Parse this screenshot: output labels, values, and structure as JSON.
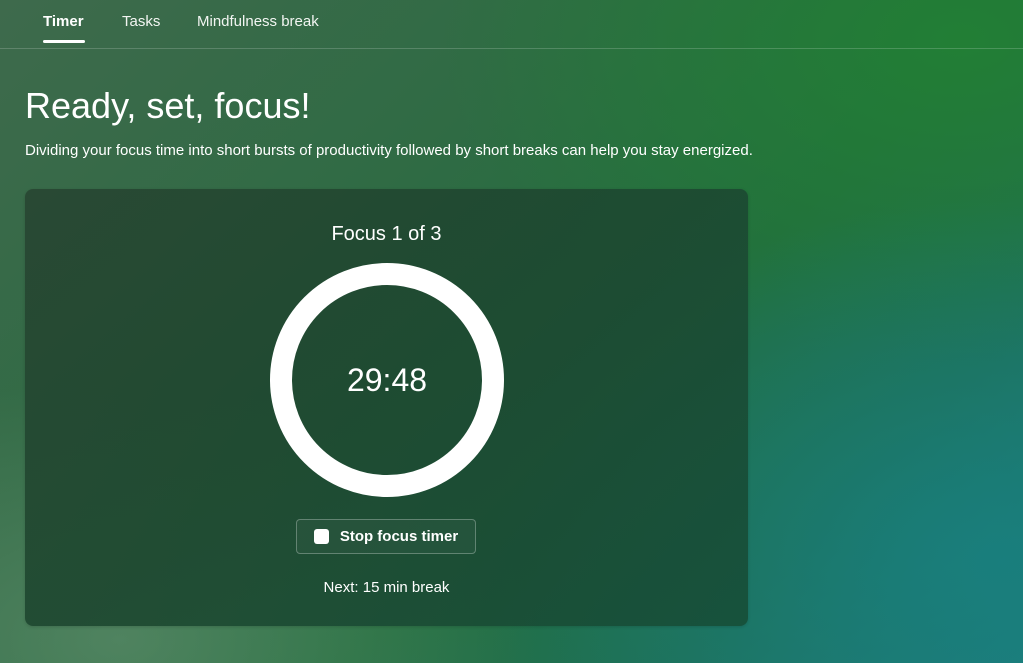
{
  "nav": {
    "tabs": [
      {
        "label": "Timer",
        "active": true
      },
      {
        "label": "Tasks",
        "active": false
      },
      {
        "label": "Mindfulness break",
        "active": false
      }
    ]
  },
  "header": {
    "title": "Ready, set, focus!",
    "subtitle": "Dividing your focus time into short bursts of productivity followed by short breaks can help you stay energized."
  },
  "timer": {
    "session_label": "Focus 1 of 3",
    "time_remaining": "29:48",
    "stop_button_label": "Stop focus timer",
    "stop_icon": "stop-icon",
    "next_label": "Next: 15 min break"
  },
  "colors": {
    "ring": "#ffffff",
    "text": "#ffffff"
  }
}
